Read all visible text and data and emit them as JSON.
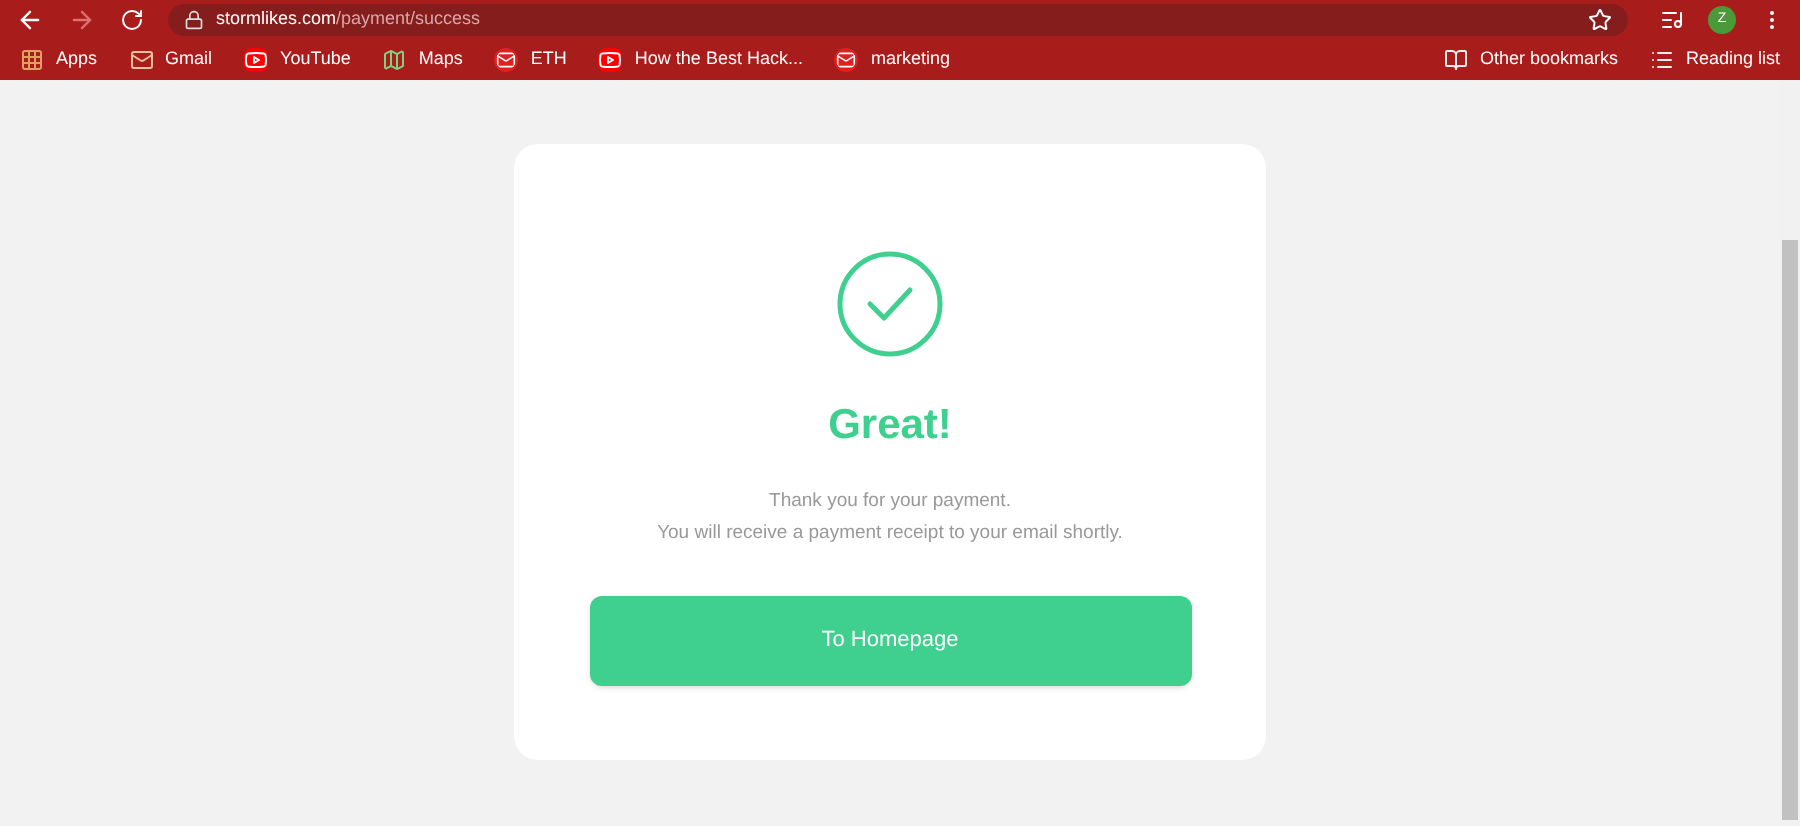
{
  "browser": {
    "url_host": "stormlikes.com",
    "url_path": "/payment/success",
    "profile_initial": "Z"
  },
  "bookmarks": [
    {
      "label": "Apps",
      "kind": "apps"
    },
    {
      "label": "Gmail",
      "kind": "gmail"
    },
    {
      "label": "YouTube",
      "kind": "youtube"
    },
    {
      "label": "Maps",
      "kind": "maps"
    },
    {
      "label": "ETH",
      "kind": "mail"
    },
    {
      "label": "How the Best Hack...",
      "kind": "youtube"
    },
    {
      "label": "marketing",
      "kind": "mail"
    }
  ],
  "bookmarks_right": [
    {
      "label": "Other bookmarks",
      "kind": "folder"
    },
    {
      "label": "Reading list",
      "kind": "list"
    }
  ],
  "card": {
    "title": "Great!",
    "message_lines": [
      "Thank you for your payment.",
      "You will receive a payment receipt to your email shortly."
    ],
    "button": "To Homepage"
  }
}
